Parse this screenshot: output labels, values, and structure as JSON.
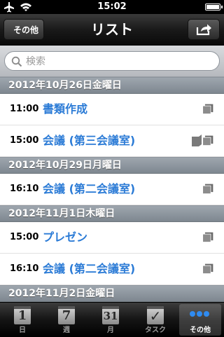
{
  "status_bar": {
    "time": "15:02"
  },
  "nav": {
    "back_label": "その他",
    "title": "リスト"
  },
  "search": {
    "placeholder": "検索"
  },
  "sections": [
    {
      "header": "2012年10月26日金曜日",
      "items": [
        {
          "time": "11:00",
          "title": "書類作成",
          "docs": 1
        },
        {
          "time": "15:00",
          "title": "会議 (第三会議室)",
          "docs": 2
        }
      ]
    },
    {
      "header": "2012年10月29日月曜日",
      "items": [
        {
          "time": "16:10",
          "title": "会議 (第二会議室)",
          "docs": 1
        }
      ]
    },
    {
      "header": "2012年11月1日木曜日",
      "items": [
        {
          "time": "15:00",
          "title": "プレゼン",
          "docs": 1
        },
        {
          "time": "16:10",
          "title": "会議 (第二会議室)",
          "docs": 1
        }
      ]
    },
    {
      "header": "2012年11月2日金曜日",
      "items": []
    }
  ],
  "tabs": [
    {
      "label": "日",
      "icon": "day-calendar-icon",
      "glyph": "1"
    },
    {
      "label": "週",
      "icon": "week-calendar-icon",
      "glyph": "7"
    },
    {
      "label": "月",
      "icon": "month-calendar-icon",
      "glyph": "31"
    },
    {
      "label": "タスク",
      "icon": "task-check-icon",
      "glyph": "✓"
    },
    {
      "label": "その他",
      "icon": "more-dots-icon",
      "glyph": ""
    }
  ],
  "active_tab": 4,
  "colors": {
    "link_blue": "#2b7bd6",
    "section_header": "#8a939c",
    "dots_blue": "#2f8bf0"
  }
}
